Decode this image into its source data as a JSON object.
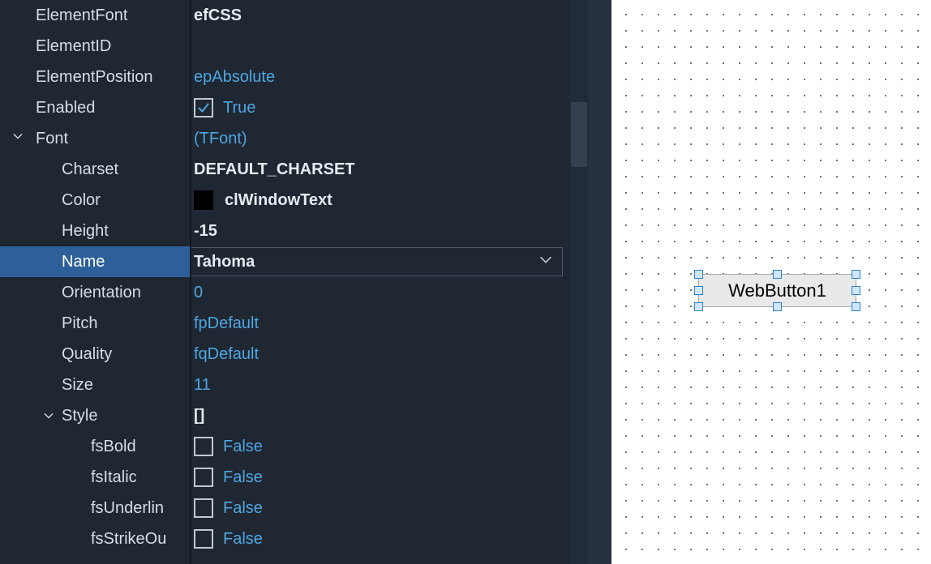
{
  "properties": {
    "ElementFont": {
      "label": "ElementFont",
      "value": "efCSS",
      "type": "bold"
    },
    "ElementID": {
      "label": "ElementID",
      "value": "",
      "type": "plain"
    },
    "ElementPosition": {
      "label": "ElementPosition",
      "value": "epAbsolute",
      "type": "link"
    },
    "Enabled": {
      "label": "Enabled",
      "value": "True",
      "type": "check-true"
    },
    "Font": {
      "label": "Font",
      "value": "(TFont)",
      "type": "link"
    },
    "Charset": {
      "label": "Charset",
      "value": "DEFAULT_CHARSET",
      "type": "bold"
    },
    "Color": {
      "label": "Color",
      "value": "clWindowText",
      "type": "color-bold"
    },
    "Height": {
      "label": "Height",
      "value": "-15",
      "type": "bold"
    },
    "Name": {
      "label": "Name",
      "value": "Tahoma",
      "type": "dropdown-bold"
    },
    "Orientation": {
      "label": "Orientation",
      "value": "0",
      "type": "link"
    },
    "Pitch": {
      "label": "Pitch",
      "value": "fpDefault",
      "type": "link"
    },
    "Quality": {
      "label": "Quality",
      "value": "fqDefault",
      "type": "link"
    },
    "Size": {
      "label": "Size",
      "value": "11",
      "type": "link"
    },
    "Style": {
      "label": "Style",
      "value": "[]",
      "type": "bold"
    },
    "fsBold": {
      "label": "fsBold",
      "value": "False",
      "type": "check-false"
    },
    "fsItalic": {
      "label": "fsItalic",
      "value": "False",
      "type": "check-false"
    },
    "fsUnderline": {
      "label": "fsUnderlin",
      "value": "False",
      "type": "check-false"
    },
    "fsStrikeOut": {
      "label": "fsStrikeOu",
      "value": "False",
      "type": "check-false"
    }
  },
  "designer": {
    "button_caption": "WebButton1"
  }
}
